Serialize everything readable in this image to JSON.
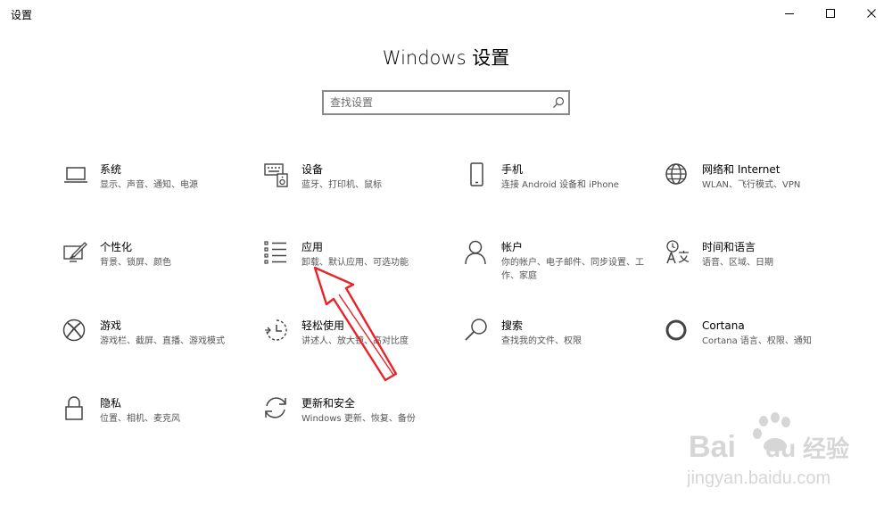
{
  "window": {
    "title": "设置"
  },
  "header": {
    "title": "Windows 设置"
  },
  "search": {
    "placeholder": "查找设置"
  },
  "tiles": [
    {
      "name": "系统",
      "desc": "显示、声音、通知、电源"
    },
    {
      "name": "设备",
      "desc": "蓝牙、打印机、鼠标"
    },
    {
      "name": "手机",
      "desc": "连接 Android 设备和 iPhone"
    },
    {
      "name": "网络和 Internet",
      "desc": "WLAN、飞行模式、VPN"
    },
    {
      "name": "个性化",
      "desc": "背景、锁屏、颜色"
    },
    {
      "name": "应用",
      "desc": "卸载、默认应用、可选功能"
    },
    {
      "name": "帐户",
      "desc": "你的帐户、电子邮件、同步设置、工作、家庭"
    },
    {
      "name": "时间和语言",
      "desc": "语音、区域、日期"
    },
    {
      "name": "游戏",
      "desc": "游戏栏、截屏、直播、游戏模式"
    },
    {
      "name": "轻松使用",
      "desc": "讲述人、放大镜、高对比度"
    },
    {
      "name": "搜索",
      "desc": "查找我的文件、权限"
    },
    {
      "name": "Cortana",
      "desc": "Cortana 语言、权限、通知"
    },
    {
      "name": "隐私",
      "desc": "位置、相机、麦克风"
    },
    {
      "name": "更新和安全",
      "desc": "Windows 更新、恢复、备份"
    }
  ],
  "colors": {
    "accent": "#e8232a",
    "icon": "#444444",
    "text": "#000000",
    "desc": "#555555"
  },
  "watermark": {
    "brand": "Bai",
    "brand_suffix": "du",
    "cn": "经验",
    "url": "jingyan.baidu.com"
  }
}
